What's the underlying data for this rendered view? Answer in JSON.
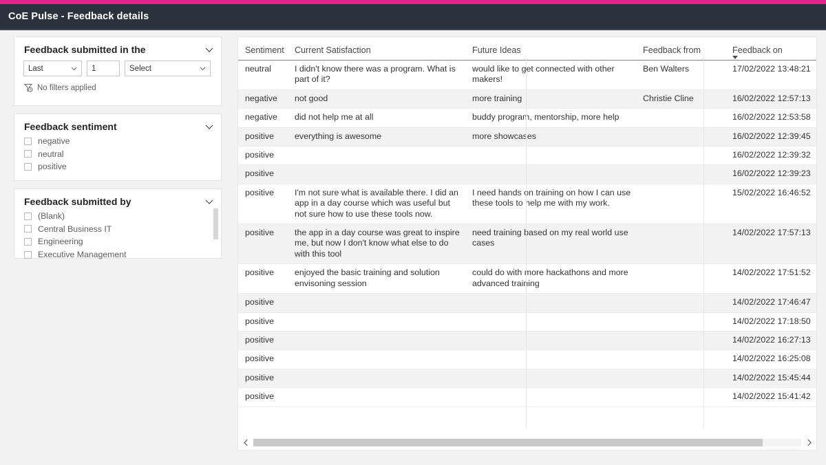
{
  "app": {
    "title": "CoE Pulse - Feedback details",
    "accent_color": "#e5258f",
    "header_bg": "#2b313d"
  },
  "filters": {
    "date_card": {
      "title": "Feedback submitted in the",
      "collapse_icon": "chevron-down-icon",
      "relation_value": "Last",
      "amount_value": "1",
      "unit_value": "Select",
      "status_text": "No filters applied",
      "status_icon": "filter-clock-icon"
    },
    "sentiment_card": {
      "title": "Feedback sentiment",
      "collapse_icon": "chevron-down-icon",
      "items": [
        {
          "label": "negative",
          "checked": false
        },
        {
          "label": "neutral",
          "checked": false
        },
        {
          "label": "positive",
          "checked": false
        }
      ]
    },
    "submitted_by_card": {
      "title": "Feedback submitted by",
      "collapse_icon": "chevron-down-icon",
      "items": [
        {
          "label": "(Blank)",
          "checked": false
        },
        {
          "label": "Central Business IT",
          "checked": false
        },
        {
          "label": "Engineering",
          "checked": false
        },
        {
          "label": "Executive Management",
          "checked": false
        }
      ]
    }
  },
  "table": {
    "columns": [
      {
        "key": "sentiment",
        "label": "Sentiment",
        "sorted": false
      },
      {
        "key": "current",
        "label": "Current Satisfaction",
        "sorted": false
      },
      {
        "key": "future",
        "label": "Future Ideas",
        "sorted": false
      },
      {
        "key": "from",
        "label": "Feedback from",
        "sorted": false
      },
      {
        "key": "on",
        "label": "Feedback on",
        "sorted": true,
        "sort_direction": "descending"
      }
    ],
    "rows": [
      {
        "sentiment": "neutral",
        "current": "I didn't know there was a program. What is part of it?",
        "future": "would like to get connected with other makers!",
        "from": "Ben Walters",
        "on": "17/02/2022 13:48:21"
      },
      {
        "sentiment": "negative",
        "current": "not good",
        "future": "more training",
        "from": "Christie Cline",
        "on": "16/02/2022 12:57:13"
      },
      {
        "sentiment": "negative",
        "current": "did not help me at all",
        "future": "buddy program, mentorship, more help",
        "from": "",
        "on": "16/02/2022 12:53:58"
      },
      {
        "sentiment": "positive",
        "current": "everything is awesome",
        "future": "more showcases",
        "from": "",
        "on": "16/02/2022 12:39:45"
      },
      {
        "sentiment": "positive",
        "current": "",
        "future": "",
        "from": "",
        "on": "16/02/2022 12:39:32"
      },
      {
        "sentiment": "positive",
        "current": "",
        "future": "",
        "from": "",
        "on": "16/02/2022 12:39:23"
      },
      {
        "sentiment": "positive",
        "current": "I'm not sure what is available there. I did an app in a day course which was useful but not sure how to use these tools now.",
        "future": "I need hands on training on how I can use these tools to help me with my work.",
        "from": "",
        "on": "15/02/2022 16:46:52"
      },
      {
        "sentiment": "positive",
        "current": "the app in a day course was great to inspire me, but now I don't know what else to do with this tool",
        "future": "need training based on my real world use cases",
        "from": "",
        "on": "14/02/2022 17:57:13"
      },
      {
        "sentiment": "positive",
        "current": "enjoyed the basic training and solution envisoning session",
        "future": "could do with more hackathons and more advanced training",
        "from": "",
        "on": "14/02/2022 17:51:52"
      },
      {
        "sentiment": "positive",
        "current": "",
        "future": "",
        "from": "",
        "on": "14/02/2022 17:46:47"
      },
      {
        "sentiment": "positive",
        "current": "",
        "future": "",
        "from": "",
        "on": "14/02/2022 17:18:50"
      },
      {
        "sentiment": "positive",
        "current": "",
        "future": "",
        "from": "",
        "on": "14/02/2022 16:27:13"
      },
      {
        "sentiment": "positive",
        "current": "",
        "future": "",
        "from": "",
        "on": "14/02/2022 16:25:08"
      },
      {
        "sentiment": "positive",
        "current": "",
        "future": "",
        "from": "",
        "on": "14/02/2022 15:45:44"
      },
      {
        "sentiment": "positive",
        "current": "",
        "future": "",
        "from": "",
        "on": "14/02/2022 15:41:42"
      }
    ],
    "scrollbar": {
      "left_icon": "chevron-left-icon",
      "right_icon": "chevron-right-icon"
    }
  }
}
